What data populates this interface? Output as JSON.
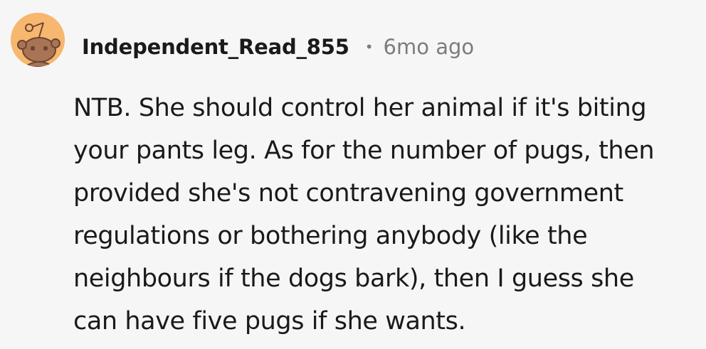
{
  "comment": {
    "avatar_icon": "snoo-avatar-icon",
    "username": "Independent_Read_855",
    "separator": "•",
    "timestamp": "6mo ago",
    "body_lines": [
      "NTB. She should control her animal if it's biting",
      "your pants leg. As for the number of pugs, then",
      "provided she's not contravening government",
      "regulations or bothering anybody (like the",
      "neighbours if the dogs bark), then I guess she",
      "can have five pugs if she wants."
    ]
  },
  "colors": {
    "background": "#f6f6f6",
    "text": "#1a1a1b",
    "muted": "#7c7c7c",
    "avatar_bg": "#f7b76f"
  }
}
